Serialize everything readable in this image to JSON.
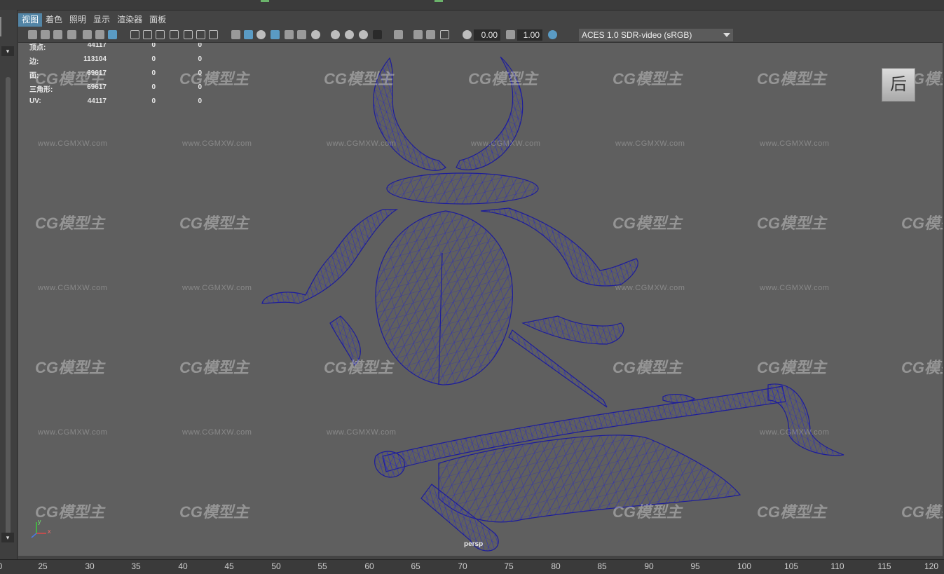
{
  "menubar": {
    "items": [
      "视图",
      "着色",
      "照明",
      "显示",
      "渲染器",
      "面板"
    ]
  },
  "toolbar": {
    "exposure_value": "0.00",
    "gamma_value": "1.00",
    "color_space": "ACES 1.0 SDR-video (sRGB)"
  },
  "hud": {
    "rows": [
      {
        "label": "顶点:",
        "v1": "44117",
        "v2": "0",
        "v3": "0"
      },
      {
        "label": "边:",
        "v1": "113104",
        "v2": "0",
        "v3": "0"
      },
      {
        "label": "面:",
        "v1": "69617",
        "v2": "0",
        "v3": "0"
      },
      {
        "label": "三角形:",
        "v1": "69617",
        "v2": "0",
        "v3": "0"
      },
      {
        "label": "UV:",
        "v1": "44117",
        "v2": "0",
        "v3": "0"
      }
    ]
  },
  "viewport": {
    "viewcube_label": "后",
    "camera_label": "persp",
    "watermark_logo": "CG模型主",
    "watermark_url": "www.CGMXW.com",
    "axes": {
      "x": "x",
      "y": "y"
    }
  },
  "timeline": {
    "ticks": [
      "0",
      "25",
      "30",
      "35",
      "40",
      "45",
      "50",
      "55",
      "60",
      "65",
      "70",
      "75",
      "80",
      "85",
      "90",
      "95",
      "100",
      "105",
      "110",
      "115",
      "120"
    ]
  }
}
